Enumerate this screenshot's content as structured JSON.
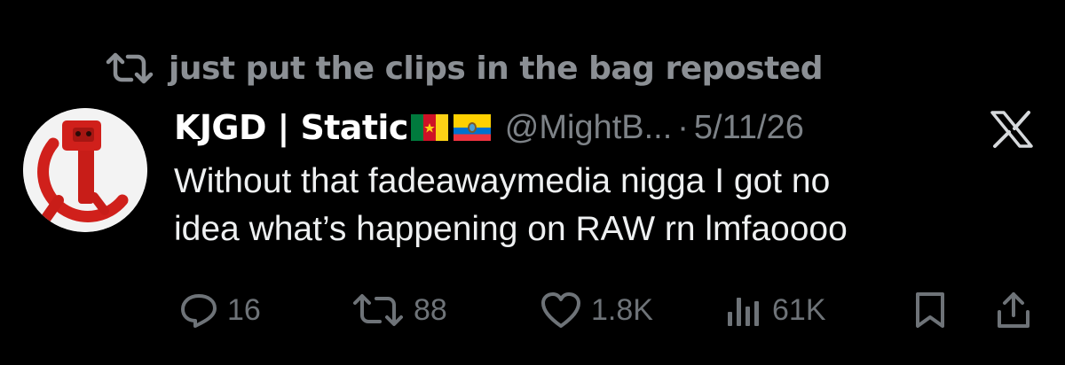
{
  "repost": {
    "text": "just put the clips in the bag reposted",
    "icon": "repost-icon"
  },
  "tweet": {
    "display_name": "KJGD | Static",
    "flags": [
      "cameroon-flag",
      "ecuador-flag"
    ],
    "handle": "@MightB...",
    "separator": "·",
    "timestamp": "5/11/26",
    "body_lines": [
      "Without that fadeawaymedia nigga I got no",
      "idea what’s happening on RAW rn lmfaoooo"
    ]
  },
  "actions": {
    "replies": "16",
    "reposts": "88",
    "likes": "1.8K",
    "views": "61K"
  },
  "colors": {
    "background": "#000000",
    "text_primary": "#eef0f1",
    "text_secondary": "#7d8287",
    "avatar_red": "#d0201b"
  }
}
